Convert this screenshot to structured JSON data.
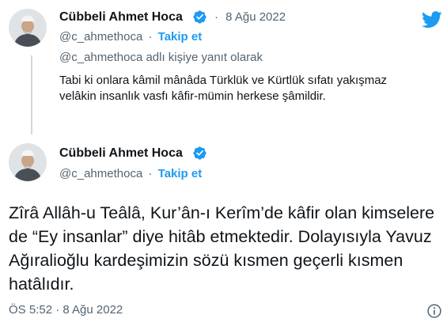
{
  "reply_tweet": {
    "author_name": "Cübbeli Ahmet Hoca",
    "separator": "·",
    "date": "8 Ağu 2022",
    "handle": "@c_ahmethoca",
    "handle_sep": "·",
    "follow_label": "Takip et",
    "replying_to": "@c_ahmethoca adlı kişiye yanıt olarak",
    "text": "Tabi ki onlara kâmil mânâda Türklük ve Kürtlük sıfatı yakışmaz velâkin insanlık vasfı kâfir-mümin herkese şâmildir."
  },
  "main_tweet": {
    "author_name": "Cübbeli Ahmet Hoca",
    "handle": "@c_ahmethoca",
    "handle_sep": "·",
    "follow_label": "Takip et",
    "text": "Zîrâ Allâh-u Teâlâ, Kur’ân-ı Kerîm’de kâfir olan kimselere de “Ey insanlar” diye hitâb etmektedir. Dolayısıyla Yavuz Ağıralioğlu kardeşimizin sözü kısmen geçerli kısmen hatâlıdır.",
    "timestamp": "ÖS 5:52 · 8 Ağu 2022"
  },
  "icons": {
    "brand": "twitter-bird-icon",
    "verified": "verified-badge-icon",
    "info": "info-icon"
  },
  "colors": {
    "accent": "#1d9bf0",
    "secondary_text": "#536471",
    "primary_text": "#0f1419"
  }
}
